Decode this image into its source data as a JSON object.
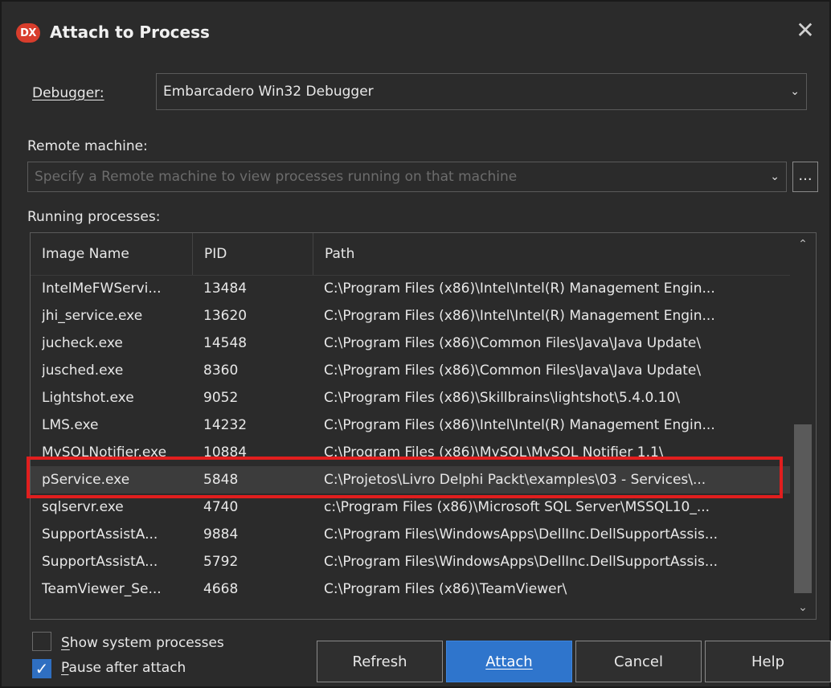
{
  "window": {
    "logo_text": "DX",
    "title": "Attach to Process",
    "close_glyph": "✕"
  },
  "debugger": {
    "label": "Debugger:",
    "value": "Embarcadero Win32 Debugger"
  },
  "remote": {
    "label": "Remote machine:",
    "placeholder": "Specify a Remote machine to view processes running on that machine",
    "browse_label": "..."
  },
  "processes": {
    "label": "Running processes:",
    "columns": [
      "Image Name",
      "PID",
      "Path"
    ],
    "rows": [
      {
        "name": "IntelMeFWServi...",
        "pid": "13484",
        "path": "C:\\Program Files (x86)\\Intel\\Intel(R) Management Engin..."
      },
      {
        "name": "jhi_service.exe",
        "pid": "13620",
        "path": "C:\\Program Files (x86)\\Intel\\Intel(R) Management Engin..."
      },
      {
        "name": "jucheck.exe",
        "pid": "14548",
        "path": "C:\\Program Files (x86)\\Common Files\\Java\\Java Update\\"
      },
      {
        "name": "jusched.exe",
        "pid": "8360",
        "path": "C:\\Program Files (x86)\\Common Files\\Java\\Java Update\\"
      },
      {
        "name": "Lightshot.exe",
        "pid": "9052",
        "path": "C:\\Program Files (x86)\\Skillbrains\\lightshot\\5.4.0.10\\"
      },
      {
        "name": "LMS.exe",
        "pid": "14232",
        "path": "C:\\Program Files (x86)\\Intel\\Intel(R) Management Engin..."
      },
      {
        "name": "MySQLNotifier.exe",
        "pid": "10884",
        "path": "C:\\Program Files (x86)\\MySQL\\MySQL Notifier 1.1\\"
      },
      {
        "name": "pService.exe",
        "pid": "5848",
        "path": "C:\\Projetos\\Livro Delphi Packt\\examples\\03 - Services\\..."
      },
      {
        "name": "sqlservr.exe",
        "pid": "4740",
        "path": "c:\\Program Files (x86)\\Microsoft SQL Server\\MSSQL10_..."
      },
      {
        "name": "SupportAssistA...",
        "pid": "9884",
        "path": "C:\\Program Files\\WindowsApps\\DellInc.DellSupportAssis..."
      },
      {
        "name": "SupportAssistA...",
        "pid": "5792",
        "path": "C:\\Program Files\\WindowsApps\\DellInc.DellSupportAssis..."
      },
      {
        "name": "TeamViewer_Se...",
        "pid": "4668",
        "path": "C:\\Program Files (x86)\\TeamViewer\\"
      }
    ],
    "selected_index": 7
  },
  "options": {
    "show_system": {
      "label": "Show system processes",
      "checked": false
    },
    "pause_after_attach": {
      "label": "Pause after attach",
      "checked": true
    }
  },
  "buttons": {
    "refresh": "Refresh",
    "attach": "Attach",
    "cancel": "Cancel",
    "help": "Help"
  },
  "colors": {
    "background": "#2b2b2b",
    "accent": "#2f75cc",
    "highlight": "#e11e1e",
    "logo": "#d83d2c"
  }
}
